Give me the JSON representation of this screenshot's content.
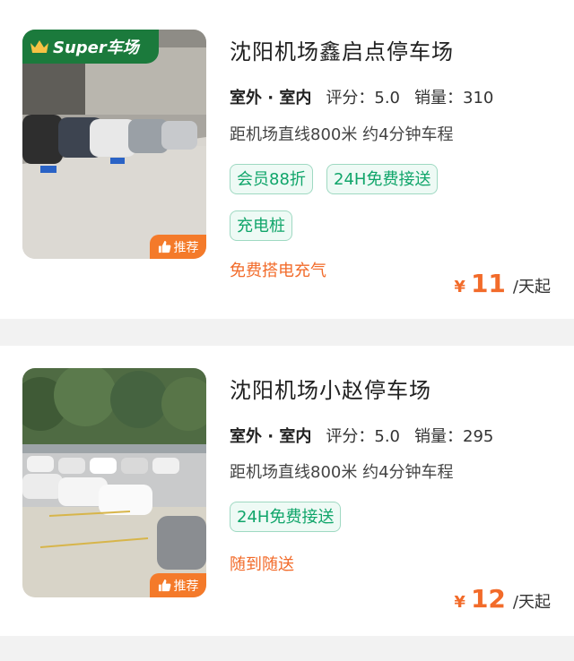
{
  "listings": [
    {
      "title": "沈阳机场鑫启点停车场",
      "environment": "室外 · 室内",
      "rating_label": "评分：5.0",
      "sales_label": "销量：310",
      "distance": "距机场直线800米 约4分钟车程",
      "badge": "Super车场",
      "recommend": "推荐",
      "tags": [
        "会员88折",
        "24H免费接送",
        "充电桩"
      ],
      "promo": "免费搭电充气",
      "price_currency": "¥",
      "price_value": "11",
      "price_unit": "/天起"
    },
    {
      "title": "沈阳机场小赵停车场",
      "environment": "室外 · 室内",
      "rating_label": "评分：5.0",
      "sales_label": "销量：295",
      "distance": "距机场直线800米 约4分钟车程",
      "recommend": "推荐",
      "tags": [
        "24H免费接送"
      ],
      "promo": "随到随送",
      "price_currency": "¥",
      "price_value": "12",
      "price_unit": "/天起"
    }
  ],
  "colors": {
    "accent_orange": "#f26b2a",
    "tag_green": "#10a56a",
    "badge_green": "#1b7a3c",
    "background": "#f2f2f2"
  }
}
